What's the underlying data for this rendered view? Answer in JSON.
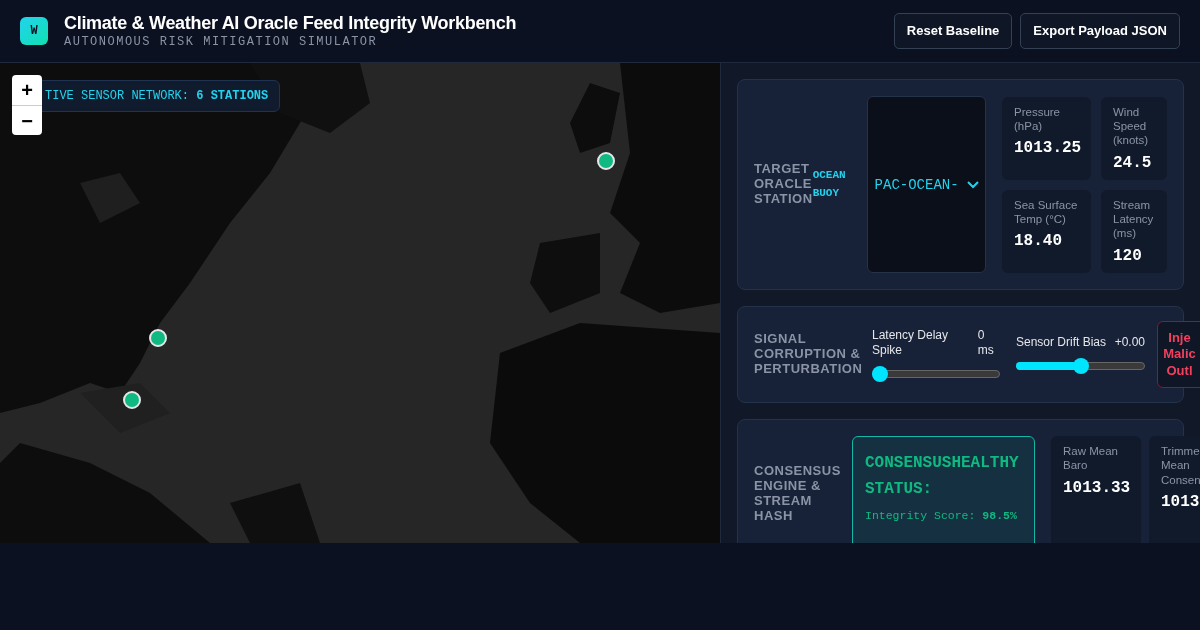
{
  "header": {
    "logo": "W",
    "title": "Climate & Weather AI Oracle Feed Integrity Workbench",
    "subtitle": "AUTONOMOUS RISK MITIGATION SIMULATOR",
    "buttons": [
      "Reset Baseline",
      "Export Payload JSON"
    ]
  },
  "map": {
    "network_label": "TIVE SENSOR NETWORK:",
    "network_count": "6 STATIONS",
    "zoom_buttons": [
      "+",
      "−"
    ],
    "markers": [
      {
        "kind": "station"
      },
      {
        "kind": "station"
      },
      {
        "kind": "station"
      }
    ]
  },
  "station_card": {
    "label": "TARGET ORACLE STATION",
    "type_tag": "OCEAN BUOY",
    "select_value": "PAC-OCEAN-",
    "metrics": [
      {
        "label": "Pressure (hPa)",
        "value": "1013.25"
      },
      {
        "label": "Wind Speed (knots)",
        "value": "24.5"
      },
      {
        "label": "Sea Surface Temp (°C)",
        "value": "18.40"
      },
      {
        "label": "Stream Latency (ms)",
        "value": "120"
      }
    ]
  },
  "corruption_card": {
    "label": "SIGNAL CORRUPTION & PERTURBATION",
    "sliders": [
      {
        "label": "Latency Delay Spike",
        "reading": "0 ms",
        "level": 0
      },
      {
        "label": "Sensor Drift Bias",
        "reading": "+0.00",
        "level": 0.5
      }
    ],
    "inject_button": [
      "Inje",
      "Malic",
      "Outl"
    ]
  },
  "consensus_card": {
    "label": "CONSENSUS ENGINE & STREAM HASH",
    "status_title": "CONSENSUSHEALTHY STATUS:",
    "status_detail": "Integrity Score: **98.5%**",
    "metrics": [
      {
        "label": "Raw Mean Baro",
        "value": "1013.33"
      },
      {
        "label": "Trimme Mean Consen",
        "value": "1013"
      }
    ]
  }
}
